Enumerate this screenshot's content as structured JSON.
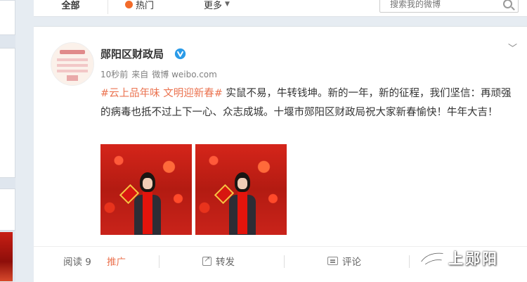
{
  "tabs": {
    "all": "全部",
    "hot": "热门",
    "more": "更多"
  },
  "search": {
    "placeholder": "搜索我的微博"
  },
  "post": {
    "username": "郧阳区财政局",
    "time": "10秒前",
    "source_prefix": "来自",
    "source": "微博 weibo.com",
    "topic": "#云上品年味 文明迎新春#",
    "text": " 实鼠不易，牛转钱坤。新的一年，新的征程，我们坚信：再顽强的病毒也抵不过上下一心、众志成城。十堰市郧阳区财政局祝大家新春愉快！牛年大吉！",
    "images": [
      "photo-1",
      "photo-2"
    ]
  },
  "actions": {
    "read_label": "阅读 9",
    "promote_label": "推广",
    "forward_label": "转发",
    "comment_label": "评论"
  },
  "watermark": {
    "text": "上郧阳"
  },
  "colors": {
    "accent": "#eb7350",
    "verified": "#2a9be8",
    "page_bg": "#e6ecf2"
  },
  "icons": [
    "fire-icon",
    "chevron-down-icon",
    "search-icon",
    "verified-icon",
    "share-icon",
    "comment-icon",
    "watermark-logo-icon"
  ]
}
